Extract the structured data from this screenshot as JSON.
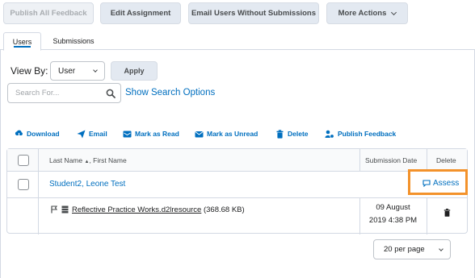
{
  "toolbar": {
    "publish_all": "Publish All Feedback",
    "edit_assignment": "Edit Assignment",
    "email_users": "Email Users Without Submissions",
    "more_actions": "More Actions"
  },
  "tabs": [
    {
      "label": "Users",
      "active": true
    },
    {
      "label": "Submissions",
      "active": false
    }
  ],
  "view": {
    "label": "View By:",
    "selected": "User",
    "apply": "Apply"
  },
  "search": {
    "placeholder": "Search For...",
    "show_options": "Show Search Options"
  },
  "actions": [
    {
      "label": "Download",
      "icon": "download-icon"
    },
    {
      "label": "Email",
      "icon": "send-icon"
    },
    {
      "label": "Mark as Read",
      "icon": "mark-read-icon"
    },
    {
      "label": "Mark as Unread",
      "icon": "mark-unread-icon"
    },
    {
      "label": "Delete",
      "icon": "trash-icon"
    },
    {
      "label": "Publish Feedback",
      "icon": "publish-feedback-icon"
    }
  ],
  "table": {
    "col_name": "Last Name",
    "col_name_sep": ", First Name",
    "col_date": "Submission Date",
    "col_delete": "Delete",
    "user_name": "Student2, Leone Test",
    "assess": "Assess",
    "file_name": "Reflective Practice Works.d2lresource",
    "file_size": "(368.68 KB)",
    "date_line1": "09 August",
    "date_line2": "2019 4:38 PM"
  },
  "pager": {
    "selected": "20 per page"
  },
  "colors": {
    "link": "#006fbf",
    "highlight": "#f3922b",
    "button_bg": "#e3e9f1"
  }
}
